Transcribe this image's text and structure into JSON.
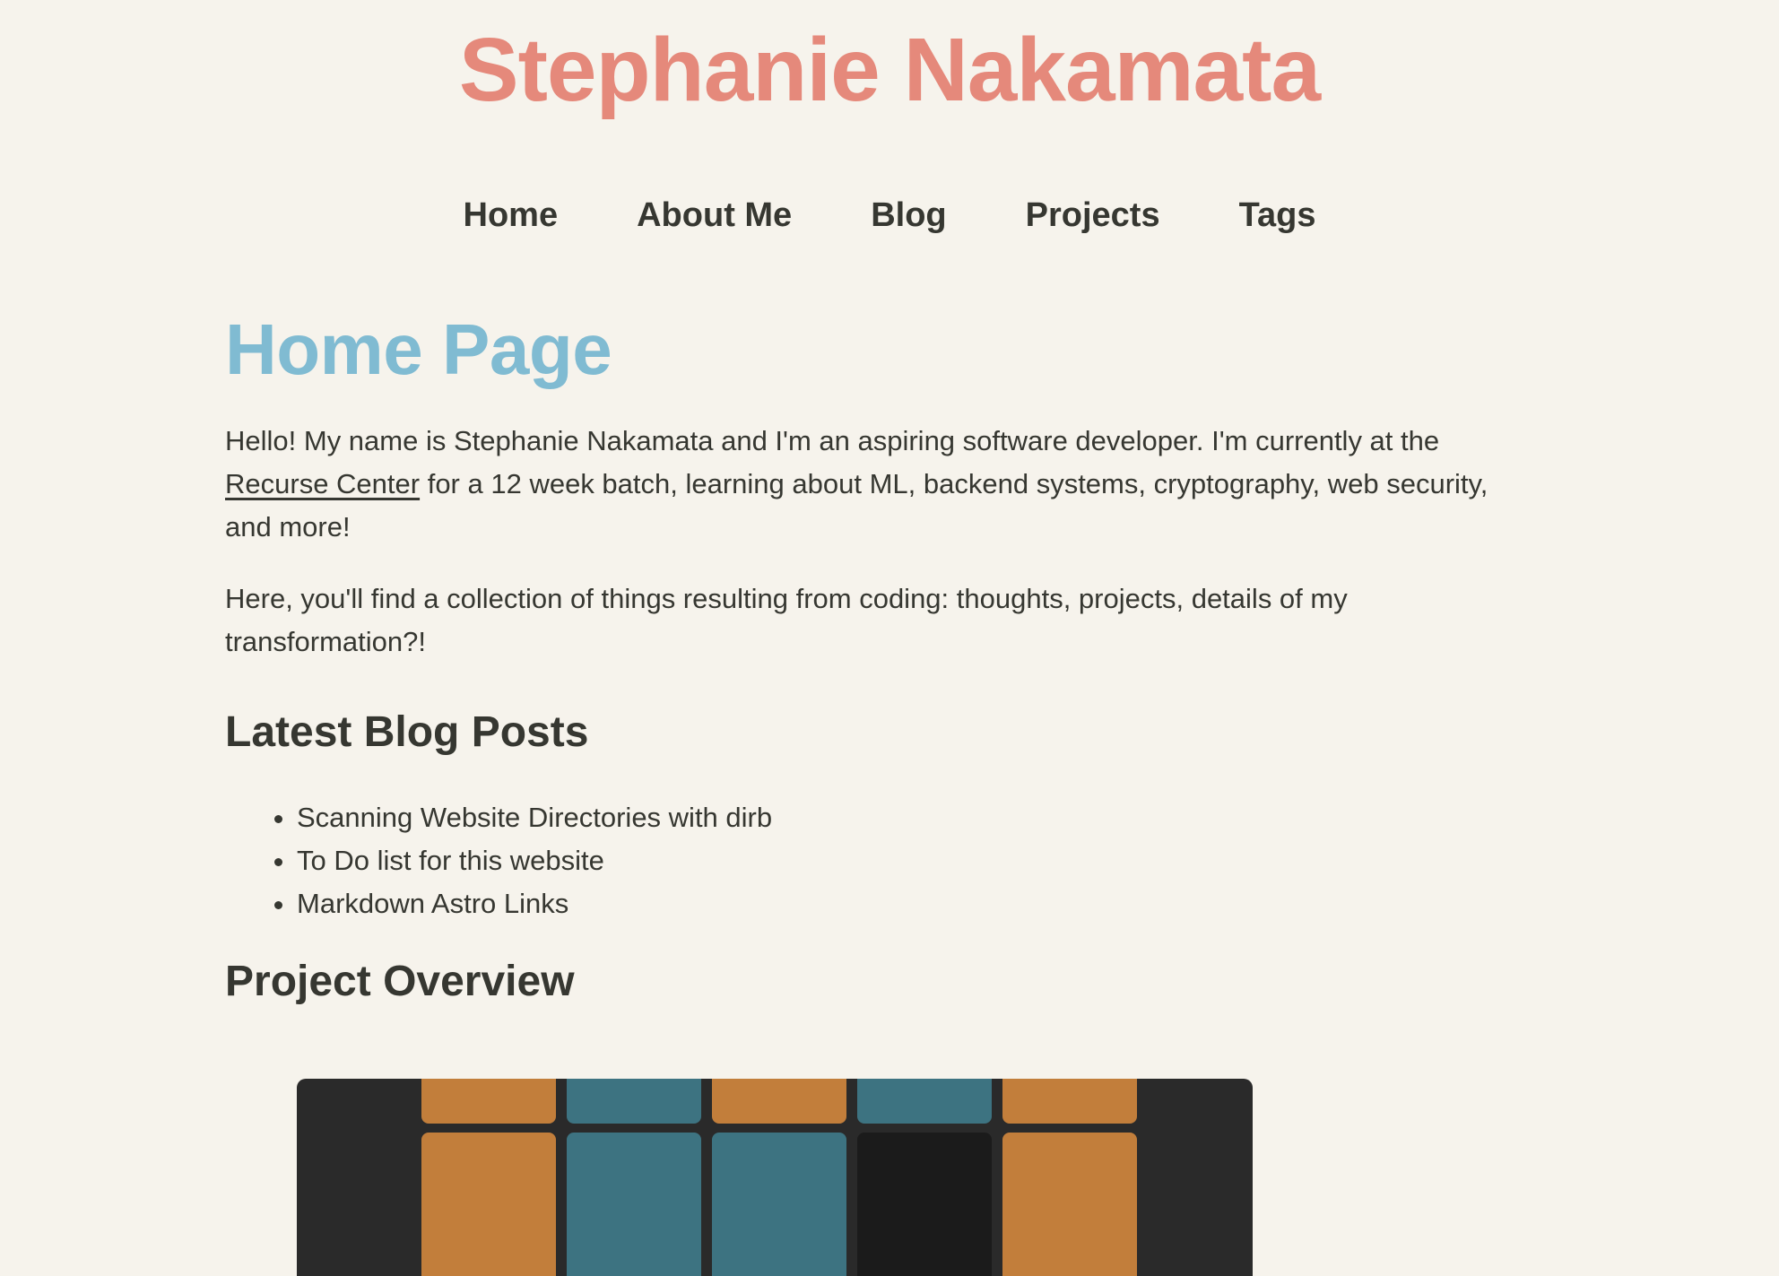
{
  "site": {
    "title": "Stephanie Nakamata",
    "title_color": "#e5897b",
    "background_color": "#f6f3ec"
  },
  "nav": {
    "items": [
      {
        "label": "Home"
      },
      {
        "label": "About Me"
      },
      {
        "label": "Blog"
      },
      {
        "label": "Projects"
      },
      {
        "label": "Tags"
      }
    ]
  },
  "main": {
    "heading": "Home Page",
    "heading_color": "#80bbd2",
    "intro_1_before": "Hello! My name is Stephanie Nakamata and I'm an aspiring software developer. I'm currently at the ",
    "intro_1_link": "Recurse Center",
    "intro_1_after": " for a 12 week batch, learning about ML, backend systems, cryptography, web security, and more!",
    "intro_2": "Here, you'll find a collection of things resulting from coding: thoughts, projects, details of my transformation?!",
    "blog_heading": "Latest Blog Posts",
    "posts": [
      {
        "title": "Scanning Website Directories with dirb"
      },
      {
        "title": "To Do list for this website"
      },
      {
        "title": "Markdown Astro Links"
      }
    ],
    "project_heading": "Project Overview",
    "project_image": {
      "description_icon": "wordle-grid-image",
      "tile_colors": {
        "orange": "#c27e3b",
        "teal": "#3d7381",
        "dark": "#1b1b1b",
        "background": "#2a2a2a"
      }
    }
  }
}
